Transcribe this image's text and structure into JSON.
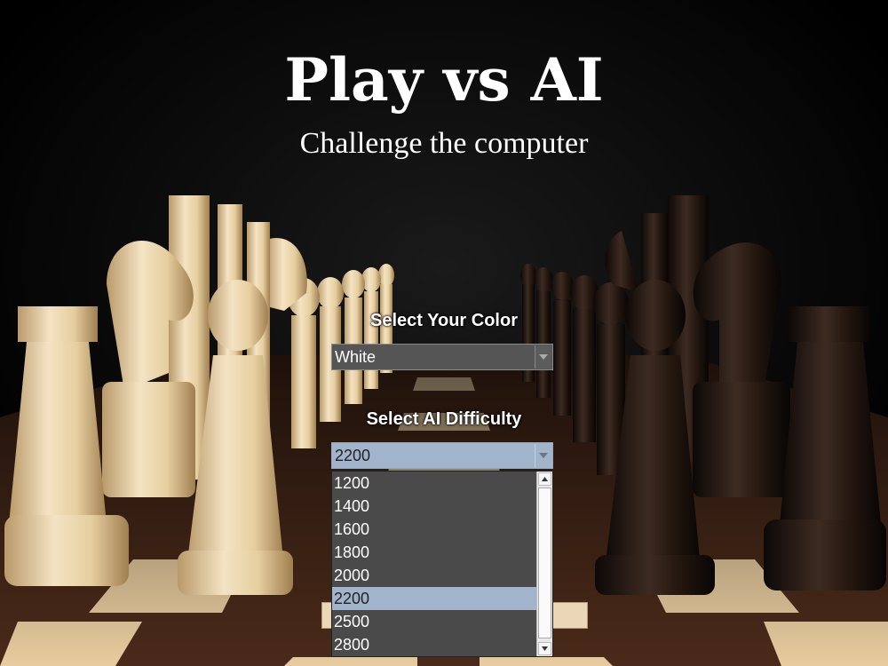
{
  "title": "Play vs AI",
  "subtitle": "Challenge the computer",
  "color_select": {
    "label": "Select Your Color",
    "value": "White"
  },
  "difficulty_select": {
    "label": "Select AI Difficulty",
    "value": "2200",
    "options": [
      "1200",
      "1400",
      "1600",
      "1800",
      "2000",
      "2200",
      "2500",
      "2800"
    ],
    "selected_option": "2200"
  },
  "colors": {
    "background": "#000000",
    "accent": "#a1b4cc",
    "combo": "#555555"
  }
}
